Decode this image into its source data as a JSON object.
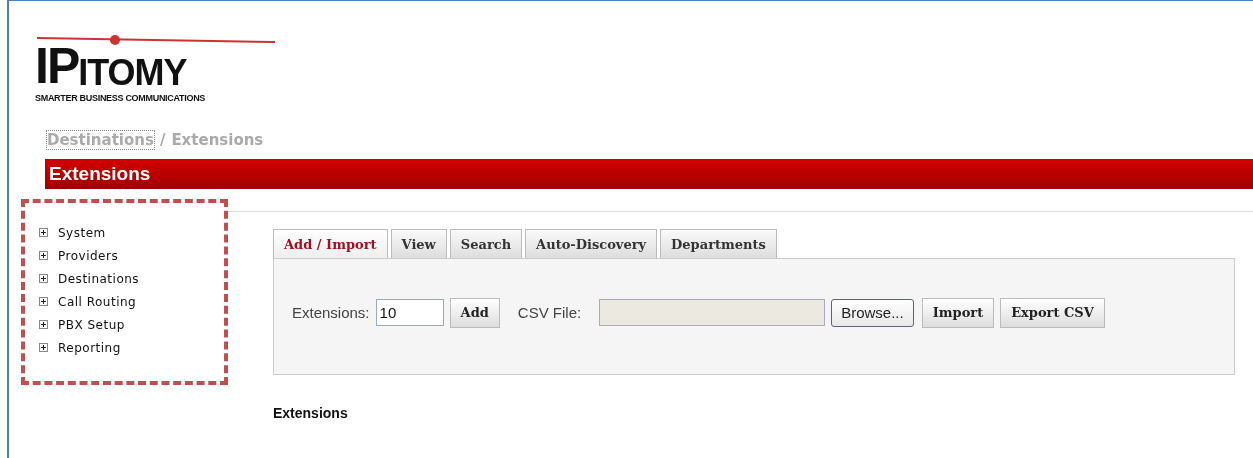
{
  "logo": {
    "wordmark_lead": "IP",
    "wordmark_rest": "ITOMY",
    "tagline": "SMARTER BUSINESS COMMUNICATIONS"
  },
  "breadcrumb": [
    {
      "label": "Destinations",
      "focused": true
    },
    {
      "label": "Extensions",
      "focused": false
    }
  ],
  "breadcrumb_separator": "/",
  "page_title": "Extensions",
  "sidebar": {
    "highlighted": true,
    "items": [
      {
        "label": "System",
        "expanded": false
      },
      {
        "label": "Providers",
        "expanded": false
      },
      {
        "label": "Destinations",
        "expanded": false
      },
      {
        "label": "Call Routing",
        "expanded": false
      },
      {
        "label": "PBX Setup",
        "expanded": false
      },
      {
        "label": "Reporting",
        "expanded": false
      }
    ]
  },
  "tabs": [
    {
      "label": "Add / Import",
      "selected": true
    },
    {
      "label": "View",
      "selected": false
    },
    {
      "label": "Search",
      "selected": false
    },
    {
      "label": "Auto-Discovery",
      "selected": false
    },
    {
      "label": "Departments",
      "selected": false
    }
  ],
  "form": {
    "extensions_label": "Extensions:",
    "extensions_value": "10",
    "add_button": "Add",
    "csv_label": "CSV File:",
    "browse_button": "Browse...",
    "import_button": "Import",
    "export_button": "Export CSV"
  },
  "section_heading": "Extensions"
}
